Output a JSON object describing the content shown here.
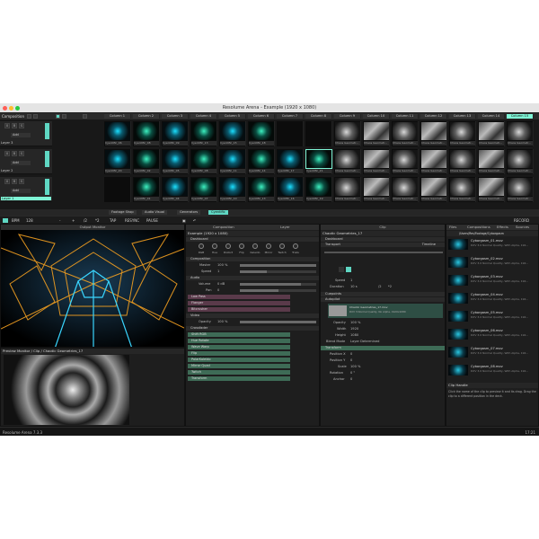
{
  "window": {
    "title": "Resolume Arena - Example (1920 x 1080)"
  },
  "topbar": {
    "composition_label": "Composition",
    "columns": [
      "Column 1",
      "Column 2",
      "Column 3",
      "Column 4",
      "Column 5",
      "Column 6",
      "Column 7",
      "Column 8",
      "Column 9",
      "Column 10",
      "Column 11",
      "Column 12",
      "Column 13",
      "Column 14",
      "Column 15"
    ]
  },
  "layers": [
    {
      "label": "Layer 3",
      "add": "Add",
      "clips": [
        "Cyentific_06",
        "Cyentific_08",
        "Cyentific_09",
        "Cyentific_13",
        "Cyentific_15",
        "Cyentific_18",
        "",
        "",
        "Chaos Geometr...",
        "Chaos Geometr...",
        "Chaos Geometr...",
        "Chaos Geometr...",
        "Chaos Geometr...",
        "Chaos Geometr...",
        "Chaos Geometr..."
      ]
    },
    {
      "label": "Layer 2",
      "add": "Add",
      "clips": [
        "Cyentific_20",
        "Cyentific_02",
        "Cyentific_05",
        "Cyentific_08",
        "Cyentific_11",
        "Cyentific_14",
        "Cyentific_17",
        "Cyentific_21",
        "Chaos Geometr...",
        "Chaos Geometr...",
        "Chaos Geometr...",
        "Chaos Geometr...",
        "Chaos Geometr...",
        "Chaos Geometr...",
        "Chaos Geometr..."
      ]
    },
    {
      "label": "Layer 1",
      "add": "Add",
      "clips": [
        "",
        "Cyentific_01",
        "Cyentific_04",
        "Cyentific_07",
        "Cyentific_10",
        "Cyentific_13",
        "Cyentific_16",
        "Cyentific_19",
        "Chaos Geometr...",
        "Chaos Geometr...",
        "Chaos Geometr...",
        "Chaos Geometr...",
        "Chaos Geometr...",
        "Chaos Geometr...",
        "Chaos Geometr..."
      ]
    }
  ],
  "decks": [
    "Footage Shop",
    "Audio Visual",
    "Generators",
    "Cyentific"
  ],
  "bpm": {
    "label": "BPM",
    "value": "128",
    "minus": "-",
    "plus": "+",
    "div": "/2",
    "mul": "*2",
    "tap": "TAP",
    "resync": "RESYNC",
    "pause": "PAUSE",
    "record": "RECORD"
  },
  "output_monitor": {
    "title": "Output Monitor"
  },
  "preview_monitor": {
    "title": "Preview Monitor / Clip / Chaotic Geometries_17"
  },
  "composition_panel": {
    "tabs": [
      "Composition",
      "Layer"
    ],
    "title": "Example (1920 x 1080)",
    "dashboard": "Dashboard",
    "knobs": [
      "RGB",
      "Hue",
      "Distort",
      "Flip",
      "Kaleido",
      "Mirror",
      "Twitch",
      "Trails"
    ],
    "composition_section": "Composition",
    "master_label": "Master",
    "master_value": "100 %",
    "speed_label": "Speed",
    "speed_value": "1",
    "audio_section": "Audio",
    "volume_label": "Volume",
    "volume_value": "0 dB",
    "pan_label": "Pan",
    "pan_value": "0",
    "effects_pink": [
      "Low Pass",
      "Flanger",
      "Bitcrusher"
    ],
    "video_section": "Video",
    "opacity_label": "Opacity",
    "opacity_value": "100 %",
    "crossfader": "Crossfader",
    "effects_green": [
      "Shift RGB",
      "Hue Rotate",
      "Wave Warp",
      "Flip",
      "PolarKaleido",
      "Mirror Quad",
      "Twitch",
      "Transform"
    ]
  },
  "clip_panel": {
    "title": "Clip",
    "clip_name": "Chaotic Geometries_17",
    "dashboard": "Dashboard",
    "transport": "Transport",
    "timeline": "Timeline",
    "speed_label": "Speed",
    "speed_value": "1",
    "duration_label": "Duration",
    "duration_value": "10 s",
    "div": "/2",
    "mul": "*2",
    "cuepoints": "Cuepoints",
    "autopilot": "Autopilot",
    "file_line1": "Chaotic Geometries_17.mov",
    "file_line2": "DXV 3 Normal Quality, No Alpha, 1920x1080",
    "opacity_label": "Opacity",
    "opacity_value": "100 %",
    "width_label": "Width",
    "width_value": "1920",
    "height_label": "Height",
    "height_value": "1080",
    "blend_label": "Blend Mode",
    "blend_value": "Layer Determined",
    "transform_section": "Transform",
    "posx_label": "Position X",
    "posx_value": "0",
    "posy_label": "Position Y",
    "posy_value": "0",
    "scale_label": "Scale",
    "scale_value": "100 %",
    "rotation_label": "Rotation",
    "rotation_value": "0 °",
    "anchor_label": "Anchor",
    "anchor_value": "0"
  },
  "files_panel": {
    "tabs": [
      "Files",
      "Compositions",
      "Effects",
      "Sources"
    ],
    "path": "/Users/Res/Footage/Cyborgasm",
    "items": [
      {
        "name": "Cyborgasm_01.mov",
        "meta": "DXV 3.0 Normal Quality, With Alpha, 192..."
      },
      {
        "name": "Cyborgasm_02.mov",
        "meta": "DXV 3.0 Normal Quality, With Alpha, 192..."
      },
      {
        "name": "Cyborgasm_03.mov",
        "meta": "DXV 3.0 Normal Quality, With Alpha, 192..."
      },
      {
        "name": "Cyborgasm_04.mov",
        "meta": "DXV 3.0 Normal Quality, With Alpha, 192..."
      },
      {
        "name": "Cyborgasm_05.mov",
        "meta": "DXV 3.0 Normal Quality, With Alpha, 192..."
      },
      {
        "name": "Cyborgasm_06.mov",
        "meta": "DXV 3.0 Normal Quality, With Alpha, 192..."
      },
      {
        "name": "Cyborgasm_07.mov",
        "meta": "DXV 3.0 Normal Quality, With Alpha, 192..."
      },
      {
        "name": "Cyborgasm_08.mov",
        "meta": "DXV 3.0 Normal Quality, With Alpha, 192..."
      }
    ],
    "help_title": "Clip Handle",
    "help_text": "Click the name of the clip to preview it and its drag. Drag the clip to a different position in the deck."
  },
  "status": {
    "app": "Resolume Arena 7.3.3",
    "time": "17:21"
  },
  "colors": {
    "accent": "#7ff5d6",
    "teal": "#5fd7c3",
    "effect_green": "#3e6b56",
    "effect_pink": "#5a3a4a"
  }
}
